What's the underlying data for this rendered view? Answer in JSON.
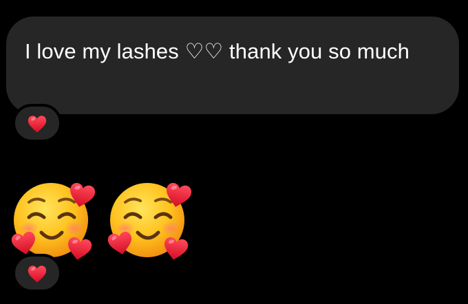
{
  "message": {
    "text": "I love my lashes ♡♡ thank you so much",
    "reaction_icon": "red-heart-icon"
  },
  "emoji_message": {
    "emojis": [
      "smiling-face-with-hearts-icon",
      "smiling-face-with-hearts-icon"
    ],
    "reaction_icon": "red-heart-icon"
  },
  "colors": {
    "background": "#000000",
    "bubble": "#262626",
    "text": "#ffffff",
    "heart": "#e8152d"
  }
}
